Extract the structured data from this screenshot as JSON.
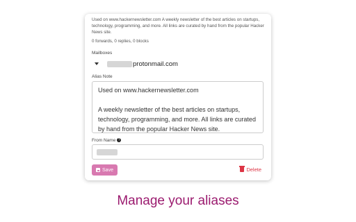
{
  "alias": {
    "description": "Used on www.hackernewsletter.com A weekly newsletter of the best articles on startups, technology, programming, and more. All links are curated by hand from the popular Hacker News site.",
    "counts": "0 forwards, 0 replies, 0 blocks"
  },
  "mailboxes": {
    "label": "Mailboxes",
    "domain": "protonmail.com"
  },
  "note": {
    "label": "Alias Note",
    "line1": "Used on www.hackernewsletter.com",
    "line2": "A weekly newsletter of the best articles on startups, technology, programming, and more. All links are curated by hand from the popular Hacker News site."
  },
  "from_name": {
    "label": "From Name"
  },
  "actions": {
    "save": "Save",
    "delete": "Delete"
  },
  "caption": "Manage your aliases",
  "colors": {
    "save_button": "#d879b0",
    "delete": "#dc3545",
    "caption": "#9b1b6f"
  }
}
